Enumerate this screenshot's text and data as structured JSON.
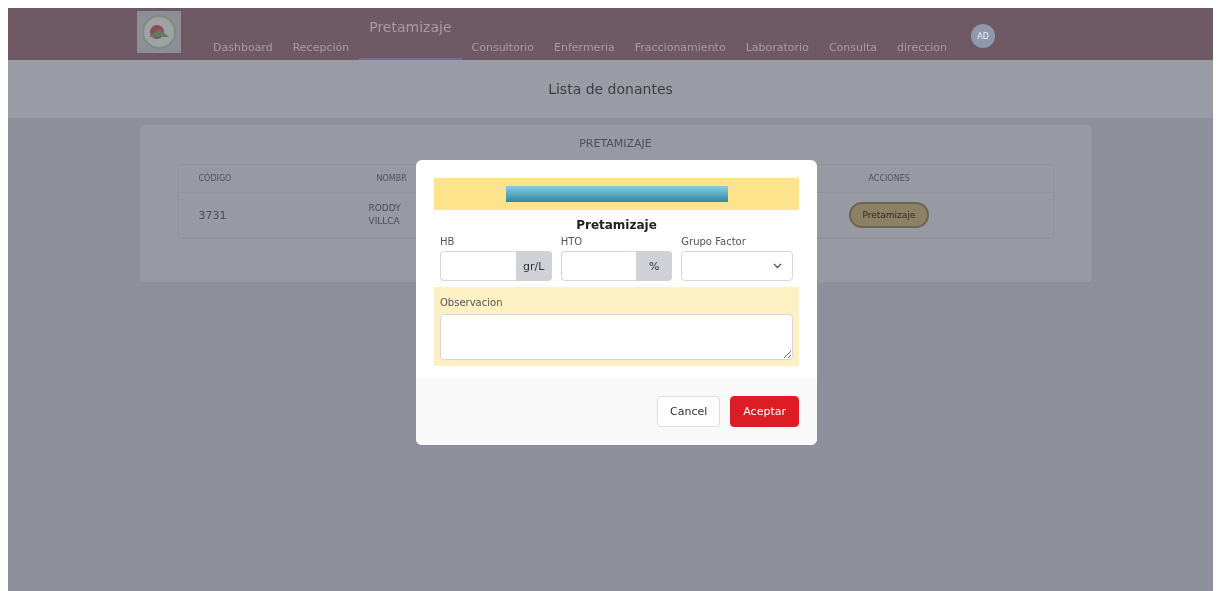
{
  "navbar": {
    "avatar": "AD",
    "items": [
      {
        "label": "Dashboard",
        "selected": false
      },
      {
        "label": "Recepción",
        "selected": false
      },
      {
        "label": "Pretamizaje",
        "selected": true
      },
      {
        "label": "Consultorio",
        "selected": false
      },
      {
        "label": "Enfermeria",
        "selected": false
      },
      {
        "label": "Fraccionamiento",
        "selected": false
      },
      {
        "label": "Laboratorio",
        "selected": false
      },
      {
        "label": "Consulta",
        "selected": false
      },
      {
        "label": "direccion",
        "selected": false
      }
    ]
  },
  "page_title": "Lista de donantes",
  "card": {
    "title": "PRETAMIZAJE",
    "columns": [
      "CÓDIGO",
      "NOMBR",
      "ACCIONES"
    ],
    "rows": [
      {
        "code": "3731",
        "name": [
          "RODDY",
          "VILLCA"
        ],
        "action": "Pretamizaje"
      }
    ]
  },
  "modal": {
    "title": "Pretamizaje",
    "fields": [
      {
        "label": "HB",
        "kind": "unit",
        "unit": "gr/L"
      },
      {
        "label": "HTO",
        "kind": "unit",
        "unit": "%"
      },
      {
        "label": "Grupo Factor",
        "kind": "select"
      }
    ],
    "observation_label": "Observacion",
    "buttons": [
      {
        "label": "Cancel",
        "kind": "secondary"
      },
      {
        "label": "Aceptar",
        "kind": "primary"
      }
    ]
  }
}
